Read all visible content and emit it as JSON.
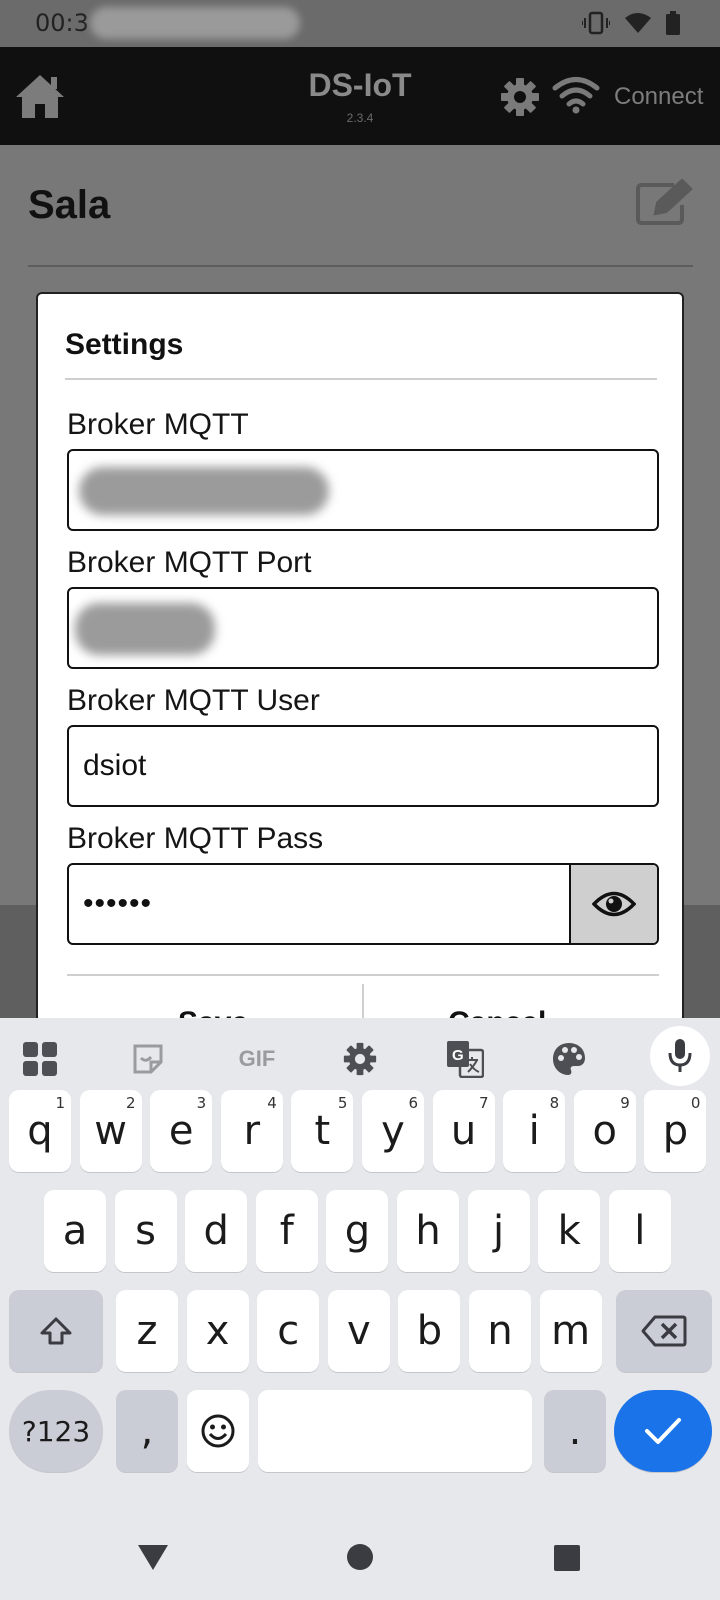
{
  "status_bar": {
    "time": "00:3"
  },
  "app_bar": {
    "title": "DS-IoT",
    "version": "2.3.4",
    "connect_label": "Connect"
  },
  "page": {
    "room_title": "Sala"
  },
  "dialog": {
    "title": "Settings",
    "fields": [
      {
        "label": "Broker MQTT",
        "value": ""
      },
      {
        "label": "Broker MQTT Port",
        "value": ""
      },
      {
        "label": "Broker MQTT User",
        "value": "dsiot"
      },
      {
        "label": "Broker MQTT Pass",
        "value": "••••••"
      }
    ],
    "save_label": "Save",
    "cancel_label": "Cancel"
  },
  "keyboard": {
    "toolbar_gif": "GIF",
    "row1": [
      "q",
      "w",
      "e",
      "r",
      "t",
      "y",
      "u",
      "i",
      "o",
      "p"
    ],
    "row1_numbers": [
      "1",
      "2",
      "3",
      "4",
      "5",
      "6",
      "7",
      "8",
      "9",
      "0"
    ],
    "row2": [
      "a",
      "s",
      "d",
      "f",
      "g",
      "h",
      "j",
      "k",
      "l"
    ],
    "row3": [
      "z",
      "x",
      "c",
      "v",
      "b",
      "n",
      "m"
    ],
    "symbols_label": "?123",
    "comma": ",",
    "period": ".",
    "accent_color": "#1a73e8"
  }
}
